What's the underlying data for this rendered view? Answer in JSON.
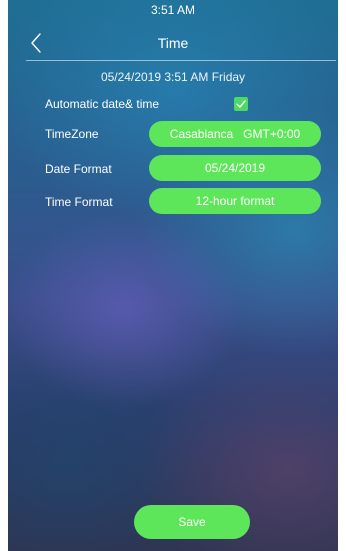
{
  "status_bar": {
    "time": "3:51 AM"
  },
  "header": {
    "title": "Time",
    "back_icon": "chevron-left-icon"
  },
  "current_datetime": "05/24/2019 3:51 AM Friday",
  "settings": {
    "auto_label": "Automatic date& time",
    "auto_checked": true,
    "timezone_label": "TimeZone",
    "timezone_value": "Casablanca   GMT+0:00",
    "date_format_label": "Date Format",
    "date_format_value": "05/24/2019",
    "time_format_label": "Time Format",
    "time_format_value": "12-hour format"
  },
  "save_label": "Save",
  "colors": {
    "accent": "#5ee65a",
    "checkbox": "#4cd964",
    "text": "#ffffff"
  }
}
